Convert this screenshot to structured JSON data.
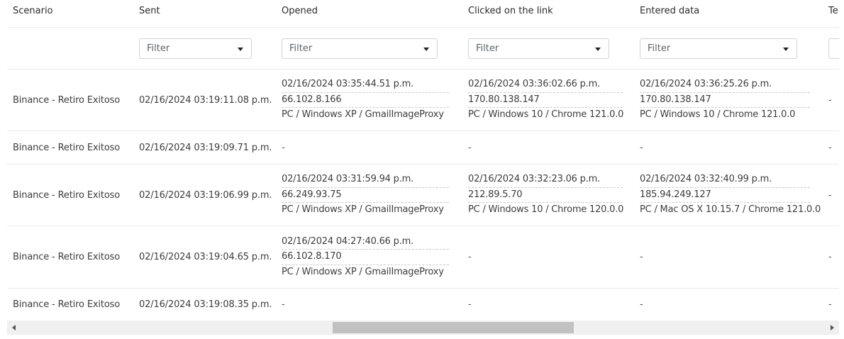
{
  "table": {
    "headers": [
      "Scenario",
      "Sent",
      "Opened",
      "Clicked on the link",
      "Entered data",
      "Te"
    ],
    "filter_placeholder": "Filter",
    "rows": [
      {
        "scenario": "Binance - Retiro Exitoso",
        "sent": "02/16/2024 03:19:11.08 p.m.",
        "opened": [
          "02/16/2024 03:35:44.51 p.m.",
          "66.102.8.166",
          "PC / Windows XP / GmailImageProxy"
        ],
        "clicked": [
          "02/16/2024 03:36:02.66 p.m.",
          "170.80.138.147",
          "PC / Windows 10 / Chrome 121.0.0"
        ],
        "entered": [
          "02/16/2024 03:36:25.26 p.m.",
          "170.80.138.147",
          "PC / Windows 10 / Chrome 121.0.0"
        ],
        "te": "-"
      },
      {
        "scenario": "Binance - Retiro Exitoso",
        "sent": "02/16/2024 03:19:09.71 p.m.",
        "opened_dash": "-",
        "clicked_dash": "-",
        "entered_dash": "-",
        "te": "-"
      },
      {
        "scenario": "Binance - Retiro Exitoso",
        "sent": "02/16/2024 03:19:06.99 p.m.",
        "opened": [
          "02/16/2024 03:31:59.94 p.m.",
          "66.249.93.75",
          "PC / Windows XP / GmailImageProxy"
        ],
        "clicked": [
          "02/16/2024 03:32:23.06 p.m.",
          "212.89.5.70",
          "PC / Windows 10 / Chrome 120.0.0"
        ],
        "entered": [
          "02/16/2024 03:32:40.99 p.m.",
          "185.94.249.127",
          "PC / Mac OS X 10.15.7 / Chrome 121.0.0"
        ],
        "te": "-"
      },
      {
        "scenario": "Binance - Retiro Exitoso",
        "sent": "02/16/2024 03:19:04.65 p.m.",
        "opened": [
          "02/16/2024 04:27:40.66 p.m.",
          "66.102.8.170",
          "PC / Windows XP / GmailImageProxy"
        ],
        "clicked_dash": "-",
        "entered_dash": "-",
        "te": "-"
      },
      {
        "scenario": "Binance - Retiro Exitoso",
        "sent": "02/16/2024 03:19:08.35 p.m.",
        "opened_dash": "-",
        "clicked_dash": "-",
        "entered_dash": "-",
        "te": "-"
      }
    ]
  }
}
